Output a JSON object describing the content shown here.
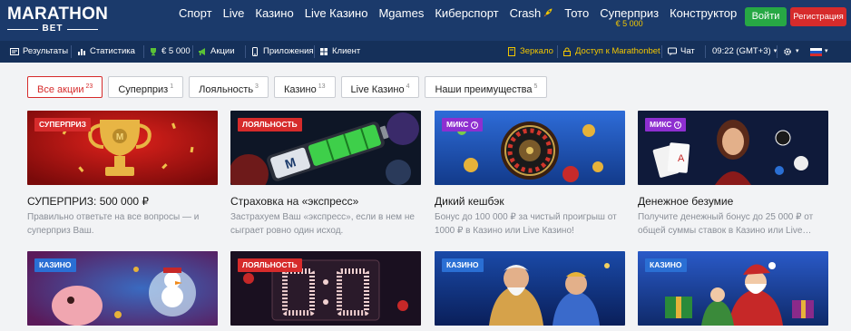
{
  "brand": {
    "name": "MARATHON",
    "sub": "BET"
  },
  "nav": [
    {
      "label": "Спорт"
    },
    {
      "label": "Live"
    },
    {
      "label": "Казино"
    },
    {
      "label": "Live Казино"
    },
    {
      "label": "Mgames"
    },
    {
      "label": "Киберспорт"
    },
    {
      "label": "Crash"
    },
    {
      "label": "Тото"
    },
    {
      "label": "Суперприз",
      "sub": "€ 5 000"
    },
    {
      "label": "Конструктор"
    }
  ],
  "auth": {
    "login": "Войти",
    "register": "Регистрация"
  },
  "subnav": {
    "results": "Результаты",
    "stats": "Статистика",
    "jackpot": "€ 5 000",
    "promo": "Акции",
    "apps": "Приложения",
    "client": "Клиент",
    "mirror": "Зеркало",
    "access": "Доступ к Marathonbet",
    "chat": "Чат",
    "time": "09:22 (GMT+3)"
  },
  "filters": [
    {
      "label": "Все акции",
      "count": "23",
      "active": true
    },
    {
      "label": "Суперприз",
      "count": "1"
    },
    {
      "label": "Лояльность",
      "count": "3"
    },
    {
      "label": "Казино",
      "count": "13"
    },
    {
      "label": "Live Казино",
      "count": "4"
    },
    {
      "label": "Наши преимущества",
      "count": "5"
    }
  ],
  "cards": [
    {
      "badge": "СУПЕРПРИЗ",
      "badge_color": "#d62b2b",
      "title": "СУПЕРПРИЗ: 500 000 ₽",
      "desc": "Правильно ответьте на все вопросы — и суперприз Ваш."
    },
    {
      "badge": "ЛОЯЛЬНОСТЬ",
      "badge_color": "#d62b2b",
      "title": "Страховка на «экспресс»",
      "desc": "Застрахуем Ваш «экспресс», если в нем не сыграет ровно один исход."
    },
    {
      "badge": "МИКС",
      "badge_color": "#8e2fd0",
      "info": true,
      "title": "Дикий кешбэк",
      "desc": "Бонус до 100 000 ₽ за чистый проигрыш от 1000 ₽ в Казино или Live Казино!"
    },
    {
      "badge": "МИКС",
      "badge_color": "#8e2fd0",
      "info": true,
      "title": "Денежное безумие",
      "desc": "Получите денежный бонус до 25 000 ₽ от общей суммы ставок в Казино или Live…"
    },
    {
      "badge": "КАЗИНО",
      "badge_color": "#2a6fd4"
    },
    {
      "badge": "ЛОЯЛЬНОСТЬ",
      "badge_color": "#d62b2b"
    },
    {
      "badge": "КАЗИНО",
      "badge_color": "#2a6fd4"
    },
    {
      "badge": "КАЗИНО",
      "badge_color": "#2a6fd4"
    }
  ]
}
